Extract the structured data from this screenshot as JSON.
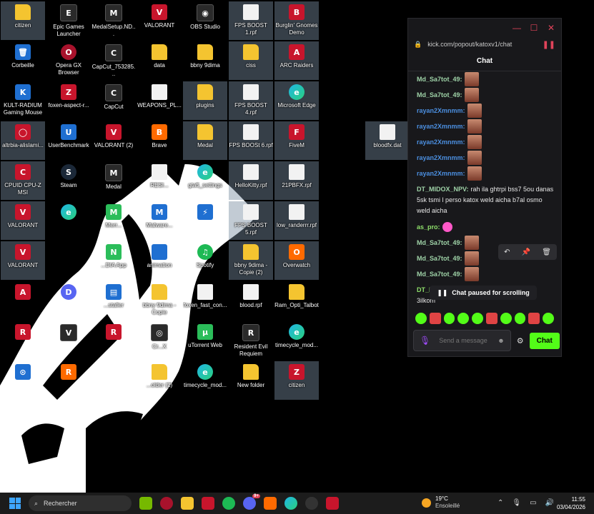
{
  "desktop": {
    "icons": [
      {
        "label": "citizen",
        "glyph": "",
        "cls": "g-folder",
        "sel": true
      },
      {
        "label": "Epic Games Launcher",
        "glyph": "E",
        "cls": "g-app",
        "sel": false
      },
      {
        "label": "MedalSetup.ND...",
        "glyph": "M",
        "cls": "g-app",
        "sel": false
      },
      {
        "label": "VALORANT",
        "glyph": "V",
        "cls": "g-red",
        "sel": false
      },
      {
        "label": "OBS Studio",
        "glyph": "◉",
        "cls": "g-app",
        "sel": false
      },
      {
        "label": "FPS BOOST 1.rpf",
        "glyph": "",
        "cls": "g-file",
        "sel": true
      },
      {
        "label": "Burglin' Gnomes Demo",
        "glyph": "B",
        "cls": "g-red",
        "sel": true
      },
      {
        "label": "Corbeille",
        "glyph": "🗑",
        "cls": "g-blue",
        "sel": false
      },
      {
        "label": "Opera GX Browser",
        "glyph": "O",
        "cls": "g-opera",
        "sel": false
      },
      {
        "label": "CapCut_753285...",
        "glyph": "C",
        "cls": "g-app",
        "sel": false
      },
      {
        "label": "data",
        "glyph": "",
        "cls": "g-folder",
        "sel": false
      },
      {
        "label": "bbny 9dima",
        "glyph": "",
        "cls": "g-folder",
        "sel": false
      },
      {
        "label": "ciss",
        "glyph": "",
        "cls": "g-folder",
        "sel": true
      },
      {
        "label": "ARC Raiders",
        "glyph": "A",
        "cls": "g-red",
        "sel": true
      },
      {
        "label": "KULT-RADIUM Gaming Mouse",
        "glyph": "K",
        "cls": "g-blue",
        "sel": false
      },
      {
        "label": "foxen-aspect-r...",
        "glyph": "Z",
        "cls": "g-red",
        "sel": false
      },
      {
        "label": "CapCut",
        "glyph": "C",
        "cls": "g-app",
        "sel": false
      },
      {
        "label": "WEAPONS_PL...",
        "glyph": "",
        "cls": "g-file",
        "sel": false
      },
      {
        "label": "plugins",
        "glyph": "",
        "cls": "g-folder",
        "sel": true
      },
      {
        "label": "FPS BOOST 4.rpf",
        "glyph": "",
        "cls": "g-file",
        "sel": true
      },
      {
        "label": "Microsoft Edge",
        "glyph": "e",
        "cls": "g-edge",
        "sel": true
      },
      {
        "label": "altrbia-alislami...",
        "glyph": "◯",
        "cls": "g-red",
        "sel": true
      },
      {
        "label": "UserBenchmark",
        "glyph": "U",
        "cls": "g-blue",
        "sel": false
      },
      {
        "label": "VALORANT (2)",
        "glyph": "V",
        "cls": "g-red",
        "sel": false
      },
      {
        "label": "Brave",
        "glyph": "B",
        "cls": "g-orange",
        "sel": false
      },
      {
        "label": "Medal",
        "glyph": "",
        "cls": "g-folder",
        "sel": true
      },
      {
        "label": "FPS BOOSt 6.rpf",
        "glyph": "",
        "cls": "g-file",
        "sel": true
      },
      {
        "label": "FiveM",
        "glyph": "F",
        "cls": "g-red",
        "sel": true
      },
      {
        "label": "bloodfx.dat",
        "glyph": "",
        "cls": "g-file",
        "sel": true
      },
      {
        "label": "CPUID CPU-Z MSI",
        "glyph": "C",
        "cls": "g-red",
        "sel": true
      },
      {
        "label": "Steam",
        "glyph": "S",
        "cls": "g-steam",
        "sel": false
      },
      {
        "label": "Medal",
        "glyph": "M",
        "cls": "g-app",
        "sel": false
      },
      {
        "label": "RESI...",
        "glyph": "",
        "cls": "g-file",
        "sel": false
      },
      {
        "label": "gta5_settings",
        "glyph": "e",
        "cls": "g-edge",
        "sel": false
      },
      {
        "label": "HelloKitty.rpf",
        "glyph": "",
        "cls": "g-file",
        "sel": true
      },
      {
        "label": "21PBFX.rpf",
        "glyph": "",
        "cls": "g-file",
        "sel": true
      },
      {
        "label": "VALORANT",
        "glyph": "V",
        "cls": "g-red",
        "sel": true
      },
      {
        "label": "",
        "glyph": "e",
        "cls": "g-edge",
        "sel": false
      },
      {
        "label": "Merr...",
        "glyph": "M",
        "cls": "g-green",
        "sel": false
      },
      {
        "label": "Malware...",
        "glyph": "M",
        "cls": "g-blue",
        "sel": false
      },
      {
        "label": "",
        "glyph": "⚡",
        "cls": "g-blue",
        "sel": false
      },
      {
        "label": "FPS BOOST 5.rpf",
        "glyph": "",
        "cls": "g-file",
        "sel": true
      },
      {
        "label": "low_randerrr.rpf",
        "glyph": "",
        "cls": "g-file",
        "sel": true
      },
      {
        "label": "VALORANT",
        "glyph": "V",
        "cls": "g-red",
        "sel": true
      },
      {
        "label": "...DIA App",
        "glyph": "N",
        "cls": "g-green",
        "sel": false
      },
      {
        "label": "animation",
        "glyph": "",
        "cls": "g-blue",
        "sel": false
      },
      {
        "label": "Spotify",
        "glyph": "♫",
        "cls": "g-spotify",
        "sel": false
      },
      {
        "label": "bbny 9dima - Copie (2)",
        "glyph": "",
        "cls": "g-folder",
        "sel": true
      },
      {
        "label": "Overwatch",
        "glyph": "O",
        "cls": "g-orange",
        "sel": true
      },
      {
        "label": "",
        "glyph": "A",
        "cls": "g-red",
        "sel": false
      },
      {
        "label": "",
        "glyph": "D",
        "cls": "g-discord",
        "sel": false
      },
      {
        "label": "...staller",
        "glyph": "▤",
        "cls": "g-blue",
        "sel": false
      },
      {
        "label": "bbny 9dima - Copie",
        "glyph": "",
        "cls": "g-folder",
        "sel": false
      },
      {
        "label": "foxen_fast_con...",
        "glyph": "",
        "cls": "g-file",
        "sel": false
      },
      {
        "label": "blood.rpf",
        "glyph": "",
        "cls": "g-file",
        "sel": false
      },
      {
        "label": "Ram_Opti_Talbot",
        "glyph": "",
        "cls": "g-folder",
        "sel": false
      },
      {
        "label": "",
        "glyph": "R",
        "cls": "g-red",
        "sel": false
      },
      {
        "label": "",
        "glyph": "V",
        "cls": "g-app",
        "sel": false
      },
      {
        "label": "",
        "glyph": "R",
        "cls": "g-red",
        "sel": false
      },
      {
        "label": "Cr...X",
        "glyph": "◎",
        "cls": "g-app",
        "sel": false
      },
      {
        "label": "uTorrent Web",
        "glyph": "μ",
        "cls": "g-green",
        "sel": false
      },
      {
        "label": "Resident Evil Requiem",
        "glyph": "R",
        "cls": "g-app",
        "sel": false
      },
      {
        "label": "timecycle_mod...",
        "glyph": "e",
        "cls": "g-edge",
        "sel": false
      },
      {
        "label": "",
        "glyph": "⊙",
        "cls": "g-blue",
        "sel": false
      },
      {
        "label": "",
        "glyph": "R",
        "cls": "g-orange",
        "sel": false
      },
      {
        "label": "...older (2)",
        "glyph": "",
        "cls": "g-folder",
        "sel": false
      },
      {
        "label": "timecycle_mod...",
        "glyph": "e",
        "cls": "g-edge",
        "sel": false
      },
      {
        "label": "New folder",
        "glyph": "",
        "cls": "g-folder",
        "sel": false
      },
      {
        "label": "citizen",
        "glyph": "Z",
        "cls": "g-red",
        "sel": true
      }
    ]
  },
  "chat_window": {
    "url": "kick.com/popout/katoxv1/chat",
    "title": "Chat",
    "window_buttons": {
      "minimize": "—",
      "maximize": "☐",
      "close": "✕"
    },
    "messages": [
      {
        "user": "Md_Sa7tot_49:",
        "color": "u-green",
        "text": "",
        "emote": true,
        "multi": false
      },
      {
        "user": "Md_Sa7tot_49:",
        "color": "u-green",
        "text": "",
        "emote": true,
        "multi": false
      },
      {
        "user": "rayan2Xmnmm:",
        "color": "u-blue",
        "text": "",
        "emote": true,
        "multi": false
      },
      {
        "user": "rayan2Xmnmm:",
        "color": "u-blue",
        "text": "",
        "emote": true,
        "multi": false
      },
      {
        "user": "rayan2Xmnmm:",
        "color": "u-blue",
        "text": "",
        "emote": true,
        "multi": false
      },
      {
        "user": "rayan2Xmnmm:",
        "color": "u-blue",
        "text": "",
        "emote": true,
        "multi": false
      },
      {
        "user": "rayan2Xmnmm:",
        "color": "u-blue",
        "text": "",
        "emote": true,
        "multi": false
      },
      {
        "user": "DT_MIDOX_NPV:",
        "color": "u-green",
        "text": "rah ila ghtrpi bss7 5ou danas 5sk tsmi l perso katox weld aicha b7al osmo weld aicha",
        "emote": false,
        "multi": true
      },
      {
        "user": "as_pro:",
        "color": "u-bright",
        "text": "",
        "emote": "pink",
        "multi": false
      },
      {
        "user": "Md_Sa7tot_49:",
        "color": "u-green",
        "text": "",
        "emote": true,
        "multi": false
      },
      {
        "user": "Md_Sa7tot_49:",
        "color": "u-green",
        "text": "",
        "emote": true,
        "multi": false
      },
      {
        "user": "Md_Sa7tot_49:",
        "color": "u-green",
        "text": "",
        "emote": true,
        "multi": false
      },
      {
        "user": "DT_BARD_NPV:",
        "color": "u-bright",
        "text": "NTA fi level talabi dewa 3ilkom",
        "emote": false,
        "multi": true
      }
    ],
    "hover_actions": [
      "↶",
      "📌",
      "🗑"
    ],
    "paused_label": "Chat paused for scrolling",
    "send_placeholder": "Send a message",
    "chat_button": "Chat"
  },
  "taskbar": {
    "search_label": "Rechercher",
    "weather_temp": "19°C",
    "weather_desc": "Ensoleillé",
    "time": "11:55",
    "date": "03/04/2026",
    "badge_count": "9+"
  }
}
